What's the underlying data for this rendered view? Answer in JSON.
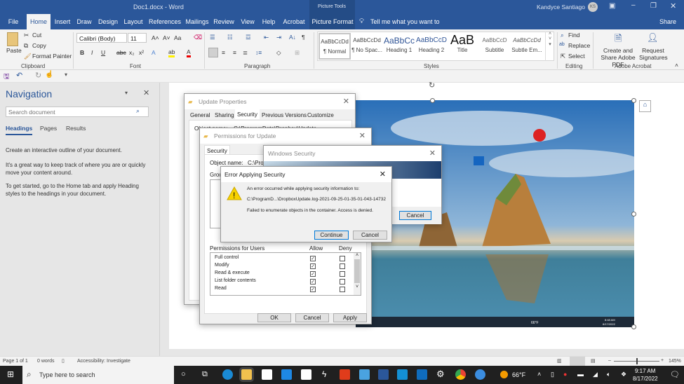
{
  "window": {
    "title": "Doc1.docx  -  Word",
    "picture_tools": "Picture Tools",
    "user": "Kandyce Santiago",
    "user_initials": "KS"
  },
  "tabs": [
    "File",
    "Home",
    "Insert",
    "Draw",
    "Design",
    "Layout",
    "References",
    "Mailings",
    "Review",
    "View",
    "Help",
    "Acrobat",
    "Picture Format"
  ],
  "active_tab": "Home",
  "tell_me": "Tell me what you want to do",
  "share": "Share",
  "ribbon": {
    "clipboard": {
      "label": "Clipboard",
      "paste": "Paste",
      "cut": "Cut",
      "copy": "Copy",
      "format_painter": "Format Painter"
    },
    "font": {
      "label": "Font",
      "family": "Calibri (Body)",
      "size": "11",
      "aa": "Aa"
    },
    "paragraph": {
      "label": "Paragraph"
    },
    "styles": {
      "label": "Styles",
      "items": [
        {
          "sample": "AaBbCcDd",
          "name": "¶ Normal"
        },
        {
          "sample": "AaBbCcDd",
          "name": "¶ No Spac..."
        },
        {
          "sample": "AaBbCc",
          "name": "Heading 1"
        },
        {
          "sample": "AaBbCcD",
          "name": "Heading 2"
        },
        {
          "sample": "AaB",
          "name": "Title"
        },
        {
          "sample": "AaBbCcD",
          "name": "Subtitle"
        },
        {
          "sample": "AaBbCcDd",
          "name": "Subtle Em..."
        }
      ]
    },
    "editing": {
      "label": "Editing",
      "find": "Find",
      "replace": "Replace",
      "select": "Select"
    },
    "acrobat": {
      "label": "Adobe Acrobat",
      "create": "Create and Share Adobe PDF",
      "request": "Request Signatures"
    }
  },
  "navigation": {
    "title": "Navigation",
    "search_placeholder": "Search document",
    "tabs": [
      "Headings",
      "Pages",
      "Results"
    ],
    "p1": "Create an interactive outline of your document.",
    "p2": "It's a great way to keep track of where you are or quickly move your content around.",
    "p3": "To get started, go to the Home tab and apply Heading styles to the headings in your document."
  },
  "dialogs": {
    "properties": {
      "title": "Update Properties",
      "tabs": [
        "General",
        "Sharing",
        "Security",
        "Previous Versions",
        "Customize"
      ],
      "active": "Security",
      "object_label": "Object name:",
      "object_value": "C:\\ProgramData\\Dropbox\\Update"
    },
    "permissions": {
      "title": "Permissions for Update",
      "tab": "Security",
      "object_label": "Object name:",
      "object_value": "C:\\Progr",
      "group_label": "Grou",
      "perm_header": "Permissions for Users",
      "allow": "Allow",
      "deny": "Deny",
      "perms": [
        {
          "name": "Full control",
          "allow": true,
          "deny": false
        },
        {
          "name": "Modify",
          "allow": true,
          "deny": false
        },
        {
          "name": "Read & execute",
          "allow": true,
          "deny": false
        },
        {
          "name": "List folder contents",
          "allow": true,
          "deny": false
        },
        {
          "name": "Read",
          "allow": true,
          "deny": false
        }
      ],
      "ok": "OK",
      "cancel": "Cancel",
      "apply": "Apply"
    },
    "winsec": {
      "title": "Windows Security",
      "cancel": "Cancel"
    },
    "error": {
      "title": "Error Applying Security",
      "line1": "An error occurred while applying security information to:",
      "path": "C:\\ProgramD...\\DropboxUpdate.log-2021-09-25-01-35-01-043-14732",
      "line3": "Failed to enumerate objects in the container. Access is denied.",
      "continue": "Continue",
      "cancel": "Cancel"
    }
  },
  "inner_taskbar": {
    "weather": "66°F",
    "time": "8:48 AM",
    "date": "8/17/2022"
  },
  "status": {
    "page": "Page 1 of 1",
    "words": "0 words",
    "accessibility": "Accessibility: Investigate",
    "zoom": "145%"
  },
  "taskbar": {
    "search_placeholder": "Type here to search",
    "weather": "66°F",
    "time": "9:17 AM",
    "date": "8/17/2022"
  }
}
